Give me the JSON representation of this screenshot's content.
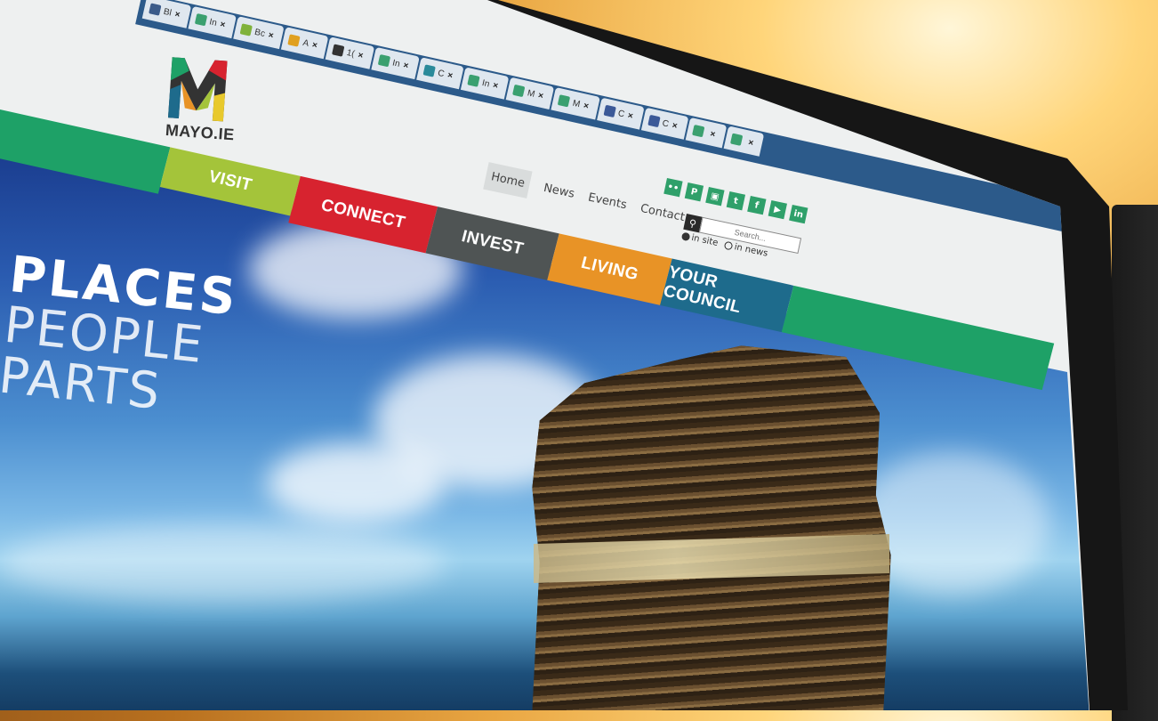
{
  "browser": {
    "tabs": [
      {
        "icon": "circle-icon",
        "color": "#3b5b8a",
        "label": "Bl"
      },
      {
        "icon": "page-icon",
        "color": "#3aa070",
        "label": "In"
      },
      {
        "icon": "page-icon",
        "color": "#7fb23c",
        "label": "Bc"
      },
      {
        "icon": "chart-icon",
        "color": "#e0a020",
        "label": "A"
      },
      {
        "icon": "camera-icon",
        "color": "#333333",
        "label": "1("
      },
      {
        "icon": "page-icon",
        "color": "#3aa070",
        "label": "In"
      },
      {
        "icon": "page-icon",
        "color": "#2a8a9a",
        "label": "C"
      },
      {
        "icon": "page-icon",
        "color": "#3aa070",
        "label": "In"
      },
      {
        "icon": "mayo-icon",
        "color": "#3aa070",
        "label": "M"
      },
      {
        "icon": "mayo-icon",
        "color": "#3aa070",
        "label": "M"
      },
      {
        "icon": "facebook-icon",
        "color": "#3b5998",
        "label": "C"
      },
      {
        "icon": "facebook-icon",
        "color": "#3b5998",
        "label": "C"
      },
      {
        "icon": "page-icon",
        "color": "#3aa070",
        "label": ""
      },
      {
        "icon": "page-icon",
        "color": "#3aa070",
        "label": ""
      }
    ]
  },
  "site": {
    "logo_text": "MAYO.IE",
    "topnav": [
      "Home",
      "News",
      "Events",
      "Contact"
    ],
    "social": [
      {
        "icon": "flickr-icon",
        "glyph": "••"
      },
      {
        "icon": "pinterest-icon",
        "glyph": "P"
      },
      {
        "icon": "instagram-icon",
        "glyph": "▣"
      },
      {
        "icon": "twitter-icon",
        "glyph": "t"
      },
      {
        "icon": "facebook-icon",
        "glyph": "f"
      },
      {
        "icon": "youtube-icon",
        "glyph": "▶"
      },
      {
        "icon": "linkedin-icon",
        "glyph": "in"
      }
    ],
    "search": {
      "placeholder": "Search...",
      "option_site": "in site",
      "option_news": "in news"
    },
    "mainnav": [
      {
        "label": "",
        "color": "#1ea167",
        "width": 196
      },
      {
        "label": "VISIT",
        "color": "#a4c43a",
        "width": 150
      },
      {
        "label": "CONNECT",
        "color": "#d7232f",
        "width": 158
      },
      {
        "label": "INVEST",
        "color": "#4f5454",
        "width": 140
      },
      {
        "label": "LIVING",
        "color": "#e89326",
        "width": 130
      },
      {
        "label": "YOUR COUNCIL",
        "color": "#1e6b8c",
        "width": 140
      },
      {
        "label": "",
        "color": "#1ea167",
        "width": 300
      }
    ],
    "hero": {
      "line1": "PLACES",
      "line2": "PEOPLE",
      "line3": "PARTS"
    }
  }
}
